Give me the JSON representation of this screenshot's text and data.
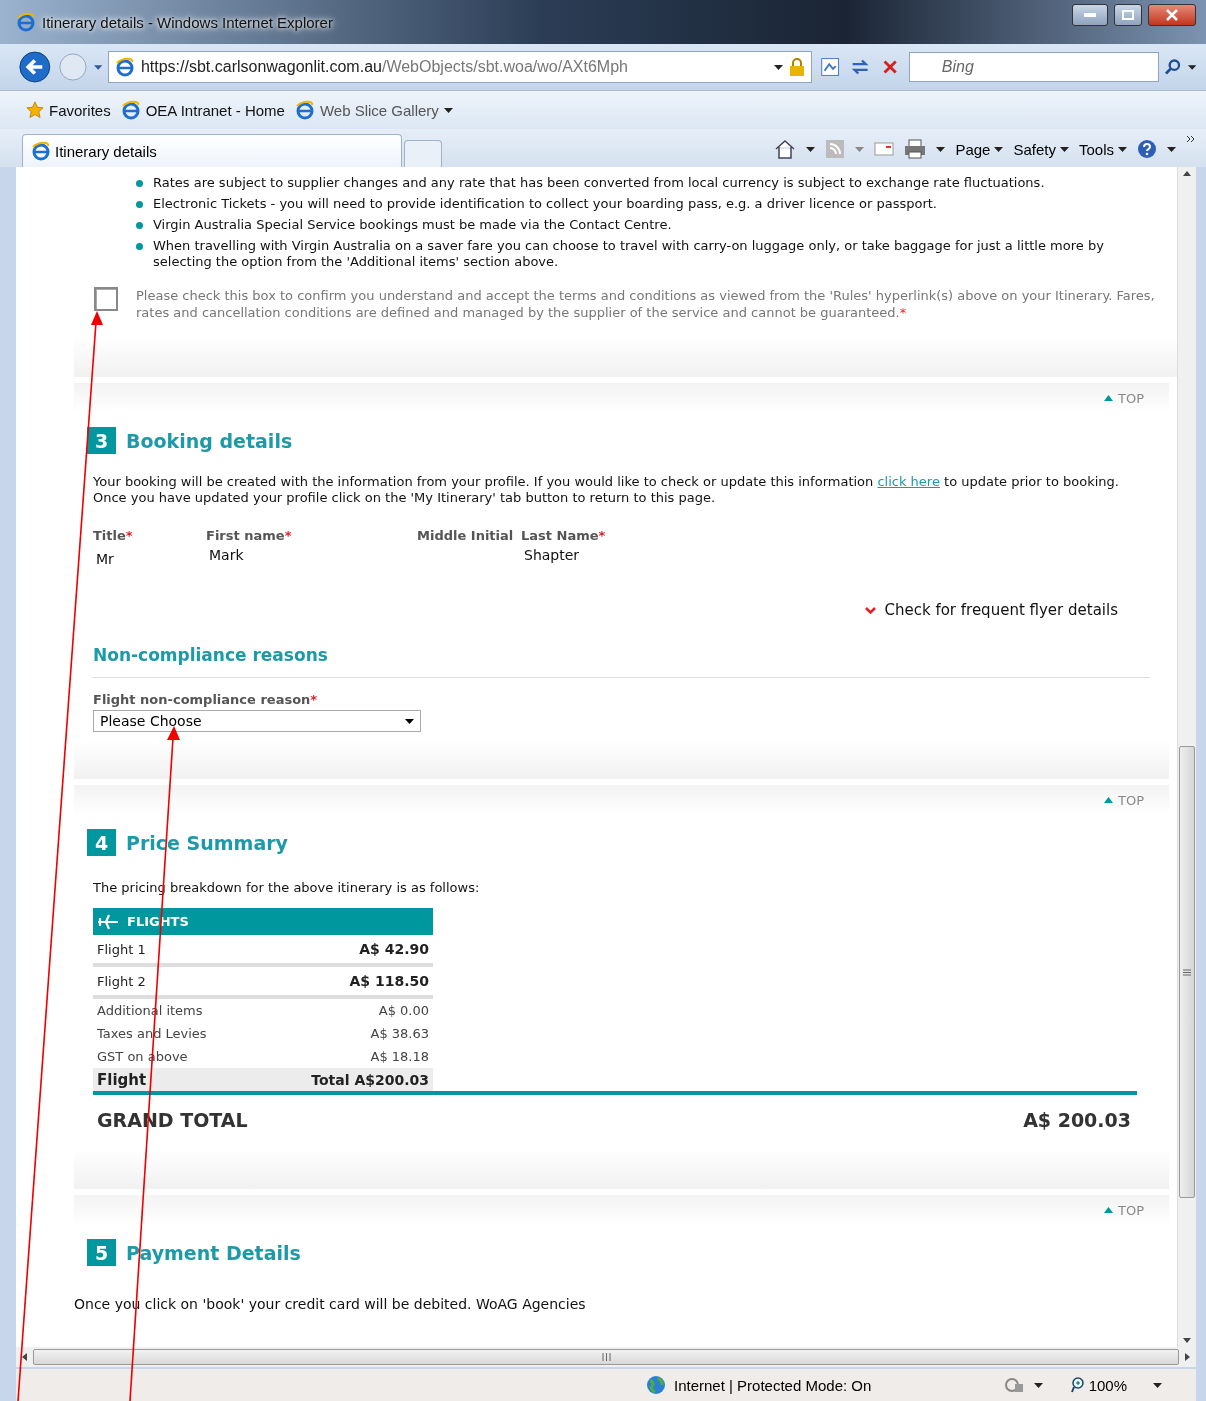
{
  "window": {
    "title": "Itinerary details - Windows Internet Explorer"
  },
  "address_bar": {
    "url_host": "https://sbt.carlsonwagonlit.com.au",
    "url_path": "/WebObjects/sbt.woa/wo/AXt6Mph"
  },
  "search": {
    "placeholder": "Bing"
  },
  "favorites_bar": [
    {
      "kind": "star",
      "label": "Favorites"
    },
    {
      "kind": "page",
      "label": "OEA Intranet - Home"
    },
    {
      "kind": "gallery",
      "label": "Web Slice Gallery"
    }
  ],
  "tabs": [
    {
      "label": "Itinerary details",
      "selected": true
    }
  ],
  "command_bar": [
    {
      "label": "Page"
    },
    {
      "label": "Safety"
    },
    {
      "label": "Tools"
    }
  ],
  "notes": [
    "Rates are subject to supplier changes and any rate that has been converted from local currency is subject to exchange rate fluctuations.",
    "Electronic Tickets - you will need to provide identification to collect your boarding pass, e.g. a driver licence or passport.",
    "Virgin Australia Special Service bookings must be made via the Contact Centre.",
    "When travelling with Virgin Australia on a saver fare you can choose to travel with carry-on luggage only, or take baggage for just a little more by selecting the option from the 'Additional items' section above."
  ],
  "terms": {
    "text": "Please check this box to confirm you understand and accept the terms and conditions as viewed from the 'Rules' hyperlink(s) above on your Itinerary. Fares, rates and cancellation conditions are defined and managed by the supplier of the service and cannot be guaranteed.",
    "marker": "*",
    "checked": false
  },
  "booking": {
    "top_link": "TOP",
    "number": "3",
    "title": "Booking details",
    "intro_before": "Your booking will be created with the information from your profile. If you would like to check or update this information ",
    "intro_link": "click here",
    "intro_after": " to update prior to booking. Once you have updated your profile click on the 'My Itinerary' tab button to return to this page.",
    "fields": [
      {
        "label": "Title",
        "marker": "*",
        "value": "Mr"
      },
      {
        "label": "First name",
        "marker": "*",
        "value": "Mark"
      },
      {
        "label": "Middle Initial"
      },
      {
        "label": "Last Name",
        "marker": "*",
        "value": "Shapter"
      }
    ],
    "frequent_flyer": "Check for frequent flyer details",
    "non_compliance": {
      "heading": "Non-compliance reasons",
      "label": "Flight non-compliance reason",
      "marker": "*",
      "select": "Please Choose"
    }
  },
  "price": {
    "top_link": "TOP",
    "number": "4",
    "title": "Price Summary",
    "intro": "The pricing breakdown for the above itinerary is as follows:",
    "header": "FLIGHTS",
    "rows": [
      {
        "kind": "flight",
        "label": "Flight 1",
        "amount": "A$ 42.90"
      },
      {
        "kind": "flight",
        "label": "Flight 2",
        "amount": "A$ 118.50"
      },
      {
        "kind": "extra",
        "label": "Additional items",
        "amount": "A$ 0.00"
      },
      {
        "kind": "extra",
        "label": "Taxes and Levies",
        "amount": "A$ 38.63"
      },
      {
        "kind": "extra",
        "label": "GST on above",
        "amount": "A$ 18.18"
      },
      {
        "kind": "total",
        "label": "Flight",
        "amount": "Total A$200.03"
      }
    ],
    "grand_total": {
      "label": "GRAND TOTAL",
      "amount": "A$ 200.03"
    }
  },
  "payment": {
    "top_link": "TOP",
    "number": "5",
    "title": "Payment Details",
    "text": "Once you click on 'book' your credit card will be debited. WoAG Agencies"
  },
  "status_bar": {
    "zone": "Internet | Protected Mode: On",
    "zoom": "100%"
  }
}
